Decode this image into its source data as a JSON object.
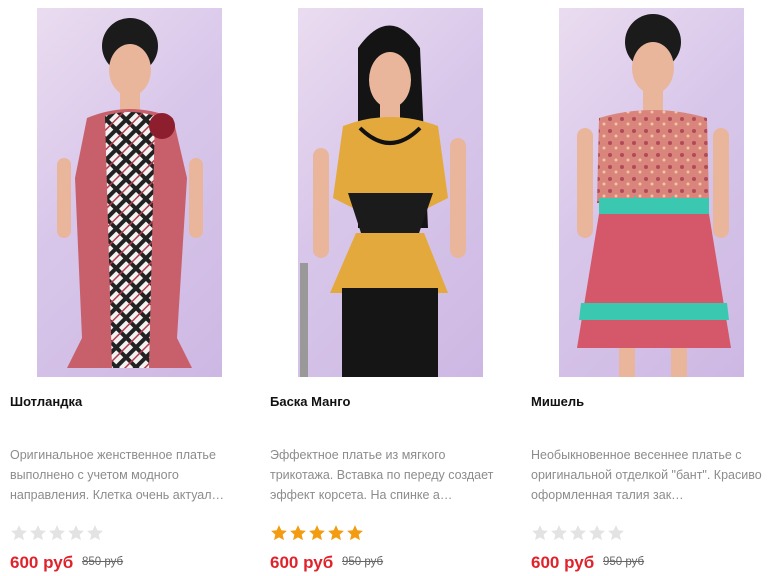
{
  "products": [
    {
      "name": "Шотландка",
      "description": "Оригинальное женственное платье выполнено с учетом модного направления. Клетка очень актуал…",
      "rating": 0,
      "price": "600 руб",
      "old_price": "850 руб"
    },
    {
      "name": "Баска Манго",
      "description": "Эффектное платье из мягкого трикотажа. Вставка по переду создает эффект корсета. На спинке а…",
      "rating": 5,
      "price": "600 руб",
      "old_price": "950 руб"
    },
    {
      "name": "Мишель",
      "description": "Необыкновенное весеннее платье с оригинальной отделкой \"бант\". Красиво оформленная талия зак…",
      "rating": 0,
      "price": "600 руб",
      "old_price": "950 руб"
    }
  ],
  "colors": {
    "price": "#e0232b",
    "star_filled": "#f39c12",
    "star_empty": "#e3e3e3"
  }
}
